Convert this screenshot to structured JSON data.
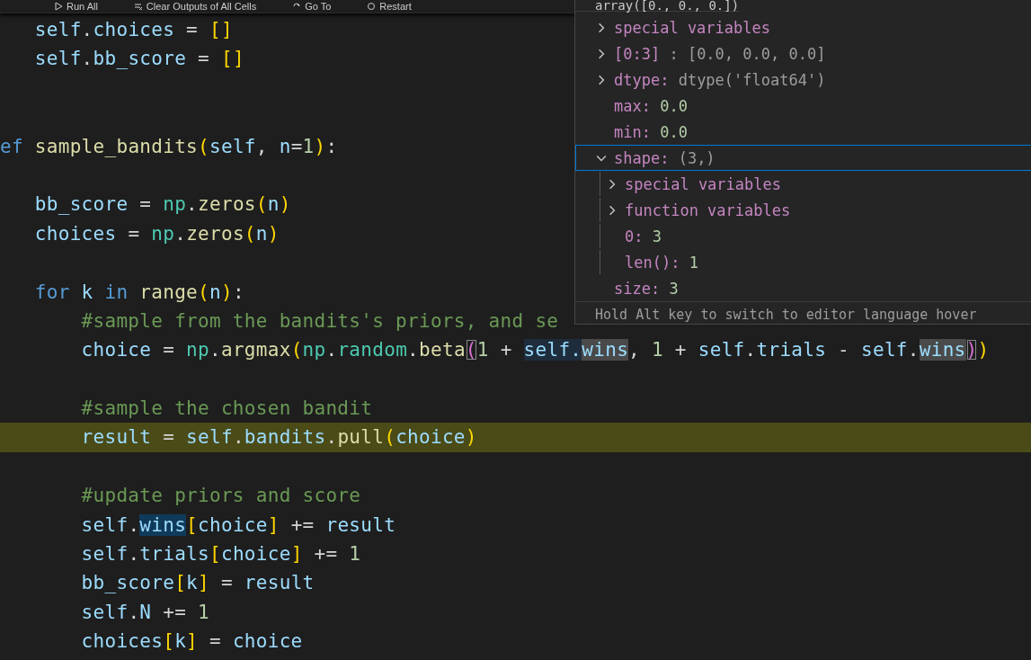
{
  "toolbar": [
    {
      "label": "Run All"
    },
    {
      "label": "Clear Outputs of All Cells"
    },
    {
      "label": "Go To"
    },
    {
      "label": "Restart"
    }
  ],
  "code": [
    {
      "highlighted": false,
      "tokens": [
        {
          "text": "   self",
          "kind": "var"
        },
        {
          "text": ".",
          "kind": "op"
        },
        {
          "text": "choices",
          "kind": "var"
        },
        {
          "text": " = ",
          "kind": "op"
        },
        {
          "text": "[]",
          "kind": "b1"
        }
      ]
    },
    {
      "highlighted": false,
      "tokens": [
        {
          "text": "   self",
          "kind": "var"
        },
        {
          "text": ".",
          "kind": "op"
        },
        {
          "text": "bb_score",
          "kind": "var"
        },
        {
          "text": " = ",
          "kind": "op"
        },
        {
          "text": "[]",
          "kind": "b1"
        }
      ]
    },
    {
      "highlighted": false
    },
    {
      "highlighted": false
    },
    {
      "highlighted": false,
      "tokens": [
        {
          "text": "ef ",
          "kind": "kw"
        },
        {
          "text": "sample_bandits",
          "kind": "fn"
        },
        {
          "text": "(",
          "kind": "b1"
        },
        {
          "text": "self",
          "kind": "var"
        },
        {
          "text": ", ",
          "kind": "op"
        },
        {
          "text": "n",
          "kind": "var"
        },
        {
          "text": "=",
          "kind": "op"
        },
        {
          "text": "1",
          "kind": "num"
        },
        {
          "text": ")",
          "kind": "b1"
        },
        {
          "text": ":",
          "kind": "op"
        }
      ]
    },
    {
      "highlighted": false
    },
    {
      "highlighted": false,
      "tokens": [
        {
          "text": "   bb_score",
          "kind": "var"
        },
        {
          "text": " = ",
          "kind": "op"
        },
        {
          "text": "np",
          "kind": "mod"
        },
        {
          "text": ".",
          "kind": "op"
        },
        {
          "text": "zeros",
          "kind": "fn"
        },
        {
          "text": "(",
          "kind": "b1"
        },
        {
          "text": "n",
          "kind": "var"
        },
        {
          "text": ")",
          "kind": "b1"
        }
      ]
    },
    {
      "highlighted": false,
      "tokens": [
        {
          "text": "   choices",
          "kind": "var"
        },
        {
          "text": " = ",
          "kind": "op"
        },
        {
          "text": "np",
          "kind": "mod"
        },
        {
          "text": ".",
          "kind": "op"
        },
        {
          "text": "zeros",
          "kind": "fn"
        },
        {
          "text": "(",
          "kind": "b1"
        },
        {
          "text": "n",
          "kind": "var"
        },
        {
          "text": ")",
          "kind": "b1"
        }
      ]
    },
    {
      "highlighted": false
    },
    {
      "highlighted": false,
      "tokens": [
        {
          "text": "   for ",
          "kind": "kw"
        },
        {
          "text": "k ",
          "kind": "var"
        },
        {
          "text": "in ",
          "kind": "kw"
        },
        {
          "text": "range",
          "kind": "fn"
        },
        {
          "text": "(",
          "kind": "b1"
        },
        {
          "text": "n",
          "kind": "var"
        },
        {
          "text": ")",
          "kind": "b1"
        },
        {
          "text": ":",
          "kind": "op"
        }
      ]
    },
    {
      "highlighted": false,
      "tokens": [
        {
          "text": "       #sample from the bandits's priors, and se",
          "kind": "comment"
        }
      ]
    },
    {
      "highlighted": false,
      "tokens": [
        {
          "text": "       choice",
          "kind": "var"
        },
        {
          "text": " = ",
          "kind": "op"
        },
        {
          "text": "np",
          "kind": "mod"
        },
        {
          "text": ".",
          "kind": "op"
        },
        {
          "text": "argmax",
          "kind": "fn"
        },
        {
          "text": "(",
          "kind": "b1"
        },
        {
          "text": "np",
          "kind": "mod"
        },
        {
          "text": ".",
          "kind": "op"
        },
        {
          "text": "random",
          "kind": "mod"
        },
        {
          "text": ".",
          "kind": "op"
        },
        {
          "text": "beta",
          "kind": "fn"
        },
        {
          "text": "(",
          "kind": "b2-match"
        },
        {
          "text": "1",
          "kind": "num"
        },
        {
          "text": " + ",
          "kind": "op"
        },
        {
          "text": "self.",
          "kind": "var-read"
        },
        {
          "text": "wins",
          "kind": "var-word"
        },
        {
          "text": ", ",
          "kind": "op"
        },
        {
          "text": "1",
          "kind": "num"
        },
        {
          "text": " + ",
          "kind": "op"
        },
        {
          "text": "self",
          "kind": "var"
        },
        {
          "text": ".",
          "kind": "op"
        },
        {
          "text": "trials",
          "kind": "var"
        },
        {
          "text": " - ",
          "kind": "op"
        },
        {
          "text": "self",
          "kind": "var"
        },
        {
          "text": ".",
          "kind": "op"
        },
        {
          "text": "wins",
          "kind": "var-word"
        },
        {
          "text": ")",
          "kind": "b2-match"
        },
        {
          "text": ")",
          "kind": "b1"
        }
      ]
    },
    {
      "highlighted": false
    },
    {
      "highlighted": false,
      "tokens": [
        {
          "text": "       #sample the chosen bandit",
          "kind": "comment"
        }
      ]
    },
    {
      "highlighted": true,
      "tokens": [
        {
          "text": "       result",
          "kind": "var"
        },
        {
          "text": " = ",
          "kind": "op"
        },
        {
          "text": "self",
          "kind": "var"
        },
        {
          "text": ".",
          "kind": "op"
        },
        {
          "text": "bandits",
          "kind": "var"
        },
        {
          "text": ".",
          "kind": "op"
        },
        {
          "text": "pull",
          "kind": "fn"
        },
        {
          "text": "(",
          "kind": "b1"
        },
        {
          "text": "choice",
          "kind": "var"
        },
        {
          "text": ")",
          "kind": "b1"
        }
      ]
    },
    {
      "highlighted": false
    },
    {
      "highlighted": false,
      "tokens": [
        {
          "text": "       #update priors and score",
          "kind": "comment"
        }
      ]
    },
    {
      "highlighted": false,
      "tokens": [
        {
          "text": "       self",
          "kind": "var"
        },
        {
          "text": ".",
          "kind": "op"
        },
        {
          "text": "wins",
          "kind": "var-write"
        },
        {
          "text": "[",
          "kind": "b1"
        },
        {
          "text": "choice",
          "kind": "var"
        },
        {
          "text": "]",
          "kind": "b1"
        },
        {
          "text": " += ",
          "kind": "op"
        },
        {
          "text": "result",
          "kind": "var"
        }
      ]
    },
    {
      "highlighted": false,
      "tokens": [
        {
          "text": "       self",
          "kind": "var"
        },
        {
          "text": ".",
          "kind": "op"
        },
        {
          "text": "trials",
          "kind": "var"
        },
        {
          "text": "[",
          "kind": "b1"
        },
        {
          "text": "choice",
          "kind": "var"
        },
        {
          "text": "]",
          "kind": "b1"
        },
        {
          "text": " += ",
          "kind": "op"
        },
        {
          "text": "1",
          "kind": "num"
        }
      ]
    },
    {
      "highlighted": false,
      "tokens": [
        {
          "text": "       bb_score",
          "kind": "var"
        },
        {
          "text": "[",
          "kind": "b1"
        },
        {
          "text": "k",
          "kind": "var"
        },
        {
          "text": "]",
          "kind": "b1"
        },
        {
          "text": " = ",
          "kind": "op"
        },
        {
          "text": "result",
          "kind": "var"
        }
      ]
    },
    {
      "highlighted": false,
      "tokens": [
        {
          "text": "       self",
          "kind": "var"
        },
        {
          "text": ".",
          "kind": "op"
        },
        {
          "text": "N",
          "kind": "var"
        },
        {
          "text": " += ",
          "kind": "op"
        },
        {
          "text": "1",
          "kind": "num"
        }
      ]
    },
    {
      "highlighted": false,
      "tokens": [
        {
          "text": "       choices",
          "kind": "var"
        },
        {
          "text": "[",
          "kind": "b1"
        },
        {
          "text": "k",
          "kind": "var"
        },
        {
          "text": "]",
          "kind": "b1"
        },
        {
          "text": " = ",
          "kind": "op"
        },
        {
          "text": "choice",
          "kind": "var"
        }
      ]
    }
  ],
  "hover": {
    "header": "array([0., 0., 0.])",
    "items": [
      {
        "name": "special variables",
        "expandable": true,
        "expanded": false,
        "selected": false
      },
      {
        "name": "[0:3]",
        "value": " : [0.0, 0.0, 0.0]",
        "kind": "text",
        "expandable": true,
        "expanded": false,
        "selected": false
      },
      {
        "name": "dtype:",
        "value": " dtype('float64')",
        "kind": "text",
        "expandable": true,
        "expanded": false,
        "selected": false
      },
      {
        "name": "max:",
        "value": " 0.0",
        "kind": "number",
        "expandable": false,
        "selected": false
      },
      {
        "name": "min:",
        "value": " 0.0",
        "kind": "number",
        "expandable": false,
        "selected": false
      },
      {
        "name": "shape:",
        "value": " (3,)",
        "kind": "text",
        "expandable": true,
        "expanded": true,
        "selected": true,
        "children": [
          {
            "name": "special variables",
            "expandable": true,
            "expanded": false,
            "selected": false
          },
          {
            "name": "function variables",
            "expandable": true,
            "expanded": false,
            "selected": false
          },
          {
            "name": "0:",
            "value": " 3",
            "kind": "number",
            "expandable": false,
            "selected": false
          },
          {
            "name": "len():",
            "value": " 1",
            "kind": "number",
            "expandable": false,
            "selected": false
          }
        ]
      },
      {
        "name": "size:",
        "value": " 3",
        "kind": "number",
        "expandable": false,
        "selected": false
      }
    ],
    "footer": "Hold Alt key to switch to editor language hover"
  }
}
